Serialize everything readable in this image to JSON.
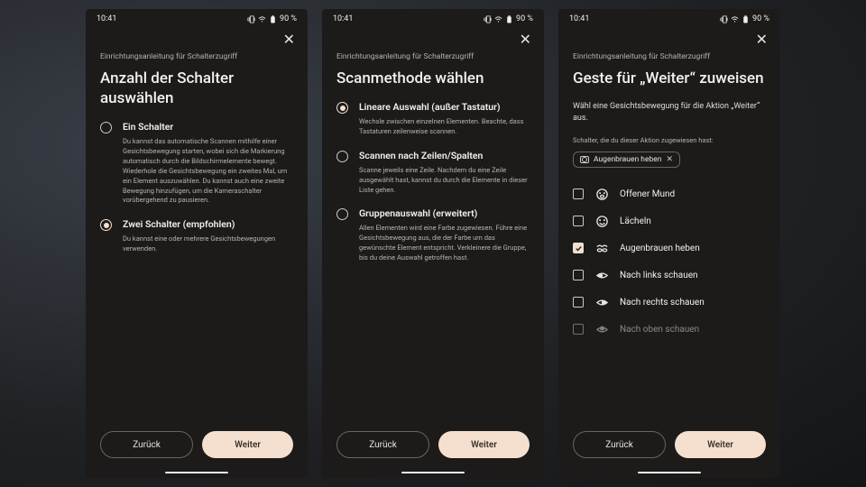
{
  "status": {
    "time": "10:41",
    "battery": "90 %"
  },
  "screens": [
    {
      "subheading": "Einrichtungsanleitung für Schalterzugriff",
      "heading": "Anzahl der Schalter auswählen",
      "options": [
        {
          "title": "Ein Schalter",
          "selected": false,
          "desc": "Du kannst das automatische Scannen mithilfe einer Gesichtsbewegung starten, wobei sich die Markierung automatisch durch die Bildschirmelemente bewegt. Wiederhole die Gesichtsbewegung ein zweites Mal, um ein Element auszuwählen. Du kannst auch eine zweite Bewegung hinzufügen, um die Kameraschalter vorübergehend zu pausieren."
        },
        {
          "title": "Zwei Schalter (empfohlen)",
          "selected": true,
          "desc": "Du kannst eine oder mehrere Gesichtsbewegungen verwenden."
        }
      ]
    },
    {
      "subheading": "Einrichtungsanleitung für Schalterzugriff",
      "heading": "Scanmethode wählen",
      "options": [
        {
          "title": "Lineare Auswahl (außer Tastatur)",
          "selected": true,
          "desc": "Wechsle zwischen einzelnen Elementen. Beachte, dass Tastaturen zeilenweise scannen."
        },
        {
          "title": "Scannen nach Zeilen/Spalten",
          "selected": false,
          "desc": "Scanne jeweils eine Zeile. Nachdem du eine Zeile ausgewählt hast, kannst du durch die Elemente in dieser Liste gehen."
        },
        {
          "title": "Gruppenauswahl (erweitert)",
          "selected": false,
          "desc": "Allen Elementen wird eine Farbe zugewiesen. Führe eine Gesichtsbewegung aus, die der Farbe um das gewünschte Element entspricht. Verkleinere die Gruppe, bis du deine Auswahl getroffen hast."
        }
      ]
    },
    {
      "subheading": "Einrichtungsanleitung für Schalterzugriff",
      "heading": "Geste für „Weiter“ zuweisen",
      "intro": "Wähl eine Gesichtsbewegung für die Aktion „Weiter“ aus.",
      "chip_label": "Schalter, die du dieser Aktion zugewiesen hast:",
      "chip": "Augenbrauen heben",
      "gestures": [
        {
          "label": "Offener Mund",
          "checked": false,
          "icon": "mouth"
        },
        {
          "label": "Lächeln",
          "checked": false,
          "icon": "smile"
        },
        {
          "label": "Augenbrauen heben",
          "checked": true,
          "icon": "eyebrows"
        },
        {
          "label": "Nach links schauen",
          "checked": false,
          "icon": "eye"
        },
        {
          "label": "Nach rechts schauen",
          "checked": false,
          "icon": "eye"
        },
        {
          "label": "Nach oben schauen",
          "checked": false,
          "icon": "eye"
        }
      ]
    }
  ],
  "buttons": {
    "back": "Zurück",
    "next": "Weiter"
  }
}
